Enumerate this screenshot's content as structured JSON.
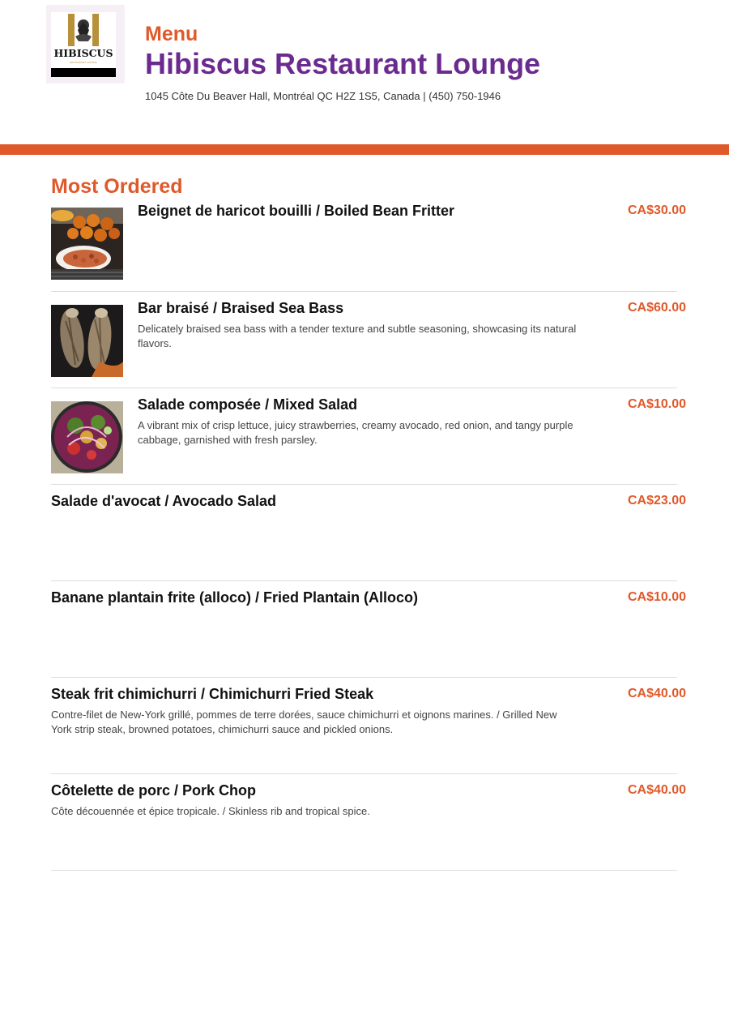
{
  "header": {
    "logo_text": "HIBISCUS",
    "menu_label": "Menu",
    "restaurant_name": "Hibiscus Restaurant Lounge",
    "address": "1045 Côte Du Beaver Hall, Montréal QC H2Z 1S5, Canada | (450) 750-1946"
  },
  "colors": {
    "accent": "#e0592a",
    "brand_purple": "#6b2a8e",
    "text": "#111111",
    "divider": "#dddddd"
  },
  "section": {
    "title": "Most Ordered",
    "items": [
      {
        "name": "Beignet de haricot bouilli / Boiled Bean Fritter",
        "description": "",
        "price": "CA$30.00",
        "image": "bean-fritter-photo"
      },
      {
        "name": "Bar braisé / Braised Sea Bass",
        "description": "Delicately braised sea bass with a tender texture and subtle seasoning, showcasing its natural flavors.",
        "price": "CA$60.00",
        "image": "sea-bass-photo"
      },
      {
        "name": "Salade composée / Mixed Salad",
        "description": "A vibrant mix of crisp lettuce, juicy strawberries, creamy avocado, red onion, and tangy purple cabbage, garnished with fresh parsley.",
        "price": "CA$10.00",
        "image": "mixed-salad-photo"
      },
      {
        "name": "Salade d'avocat / Avocado Salad",
        "description": "",
        "price": "CA$23.00"
      },
      {
        "name": "Banane plantain frite (alloco) / Fried Plantain (Alloco)",
        "description": "",
        "price": "CA$10.00"
      },
      {
        "name": "Steak frit chimichurri / Chimichurri Fried Steak",
        "description": "Contre-filet de New-York grillé, pommes de terre dorées, sauce chimichurri et oignons marines. / Grilled New York strip steak, browned potatoes, chimichurri sauce and pickled onions.",
        "price": "CA$40.00"
      },
      {
        "name": "Côtelette de porc / Pork Chop",
        "description": "Côte découennée et épice tropicale. / Skinless rib and tropical spice.",
        "price": "CA$40.00"
      }
    ]
  }
}
